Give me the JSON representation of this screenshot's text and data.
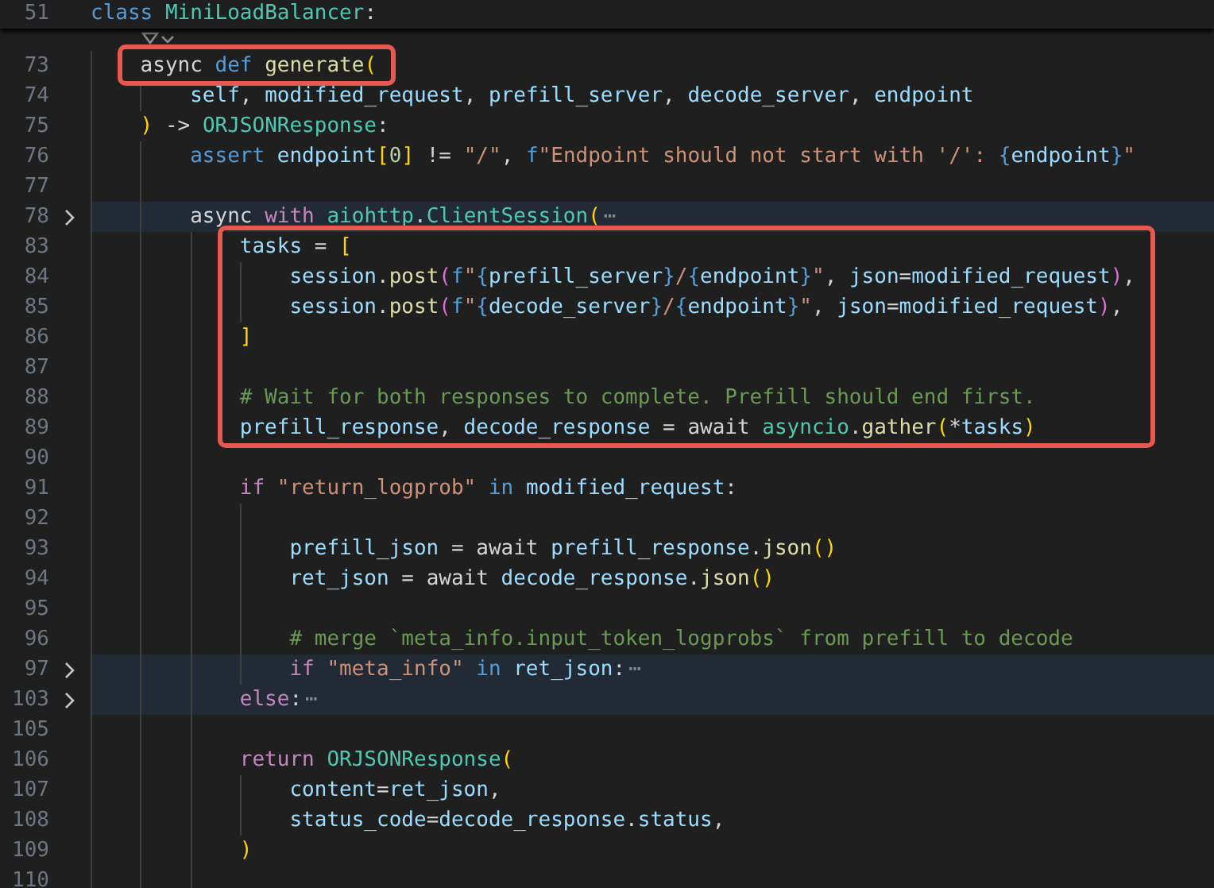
{
  "editor": {
    "sticky_line": {
      "number": "51",
      "tokens": [
        {
          "text": "class ",
          "kind": "kw"
        },
        {
          "text": "MiniLoadBalancer",
          "kind": "cls"
        },
        {
          "text": ":",
          "kind": "plain"
        }
      ]
    },
    "lines": [
      {
        "number": "73",
        "folded": false,
        "boxed": true,
        "tokens": [
          {
            "text": "async ",
            "kind": "plain"
          },
          {
            "text": "def ",
            "kind": "kw"
          },
          {
            "text": "generate",
            "kind": "fn"
          },
          {
            "text": "(",
            "kind": "br1"
          }
        ],
        "children": [
          {
            "number": "74",
            "folded": false,
            "boxed": false,
            "tokens": [
              {
                "text": "self",
                "kind": "var"
              },
              {
                "text": ", ",
                "kind": "plain"
              },
              {
                "text": "modified_request",
                "kind": "var"
              },
              {
                "text": ", ",
                "kind": "plain"
              },
              {
                "text": "prefill_server",
                "kind": "var"
              },
              {
                "text": ", ",
                "kind": "plain"
              },
              {
                "text": "decode_server",
                "kind": "var"
              },
              {
                "text": ", ",
                "kind": "plain"
              },
              {
                "text": "endpoint",
                "kind": "var"
              }
            ]
          }
        ]
      },
      {
        "number": "75",
        "folded": false,
        "boxed": false,
        "tokens": [
          {
            "text": ")",
            "kind": "br1"
          },
          {
            "text": " -> ",
            "kind": "plain"
          },
          {
            "text": "ORJSONResponse",
            "kind": "cls"
          },
          {
            "text": ":",
            "kind": "plain"
          }
        ],
        "children": [
          {
            "number": "76",
            "folded": false,
            "boxed": false,
            "tokens": [
              {
                "text": "assert ",
                "kind": "kw"
              },
              {
                "text": "endpoint",
                "kind": "var"
              },
              {
                "text": "[",
                "kind": "br1"
              },
              {
                "text": "0",
                "kind": "num"
              },
              {
                "text": "]",
                "kind": "br1"
              },
              {
                "text": " != ",
                "kind": "plain"
              },
              {
                "text": "\"/\"",
                "kind": "str"
              },
              {
                "text": ", ",
                "kind": "plain"
              },
              {
                "text": "f",
                "kind": "kw"
              },
              {
                "text": "\"Endpoint should not start with '/': ",
                "kind": "str"
              },
              {
                "text": "{",
                "kind": "fmt"
              },
              {
                "text": "endpoint",
                "kind": "var"
              },
              {
                "text": "}",
                "kind": "fmt"
              },
              {
                "text": "\"",
                "kind": "str"
              }
            ]
          },
          {
            "number": "77",
            "folded": false,
            "boxed": false
          },
          {
            "number": "78",
            "folded": true,
            "boxed": false,
            "tokens": [
              {
                "text": "async ",
                "kind": "plain"
              },
              {
                "text": "with ",
                "kind": "ctl"
              },
              {
                "text": "aiohttp",
                "kind": "cls"
              },
              {
                "text": ".",
                "kind": "plain"
              },
              {
                "text": "ClientSession",
                "kind": "cls"
              },
              {
                "text": "(",
                "kind": "br1"
              },
              {
                "text": "⋯",
                "kind": "fold"
              }
            ],
            "children": [
              {
                "number": "83",
                "folded": false,
                "boxed": true,
                "tokens": [
                  {
                    "text": "tasks",
                    "kind": "var"
                  },
                  {
                    "text": " = ",
                    "kind": "plain"
                  },
                  {
                    "text": "[",
                    "kind": "br1"
                  }
                ],
                "children": [
                  {
                    "number": "84",
                    "folded": false,
                    "boxed": true,
                    "tokens": [
                      {
                        "text": "session",
                        "kind": "var"
                      },
                      {
                        "text": ".",
                        "kind": "plain"
                      },
                      {
                        "text": "post",
                        "kind": "fn"
                      },
                      {
                        "text": "(",
                        "kind": "br2"
                      },
                      {
                        "text": "f",
                        "kind": "kw"
                      },
                      {
                        "text": "\"",
                        "kind": "str"
                      },
                      {
                        "text": "{",
                        "kind": "fmt"
                      },
                      {
                        "text": "prefill_server",
                        "kind": "var"
                      },
                      {
                        "text": "}",
                        "kind": "fmt"
                      },
                      {
                        "text": "/",
                        "kind": "str"
                      },
                      {
                        "text": "{",
                        "kind": "fmt"
                      },
                      {
                        "text": "endpoint",
                        "kind": "var"
                      },
                      {
                        "text": "}",
                        "kind": "fmt"
                      },
                      {
                        "text": "\"",
                        "kind": "str"
                      },
                      {
                        "text": ", ",
                        "kind": "plain"
                      },
                      {
                        "text": "json",
                        "kind": "var"
                      },
                      {
                        "text": "=",
                        "kind": "plain"
                      },
                      {
                        "text": "modified_request",
                        "kind": "var"
                      },
                      {
                        "text": ")",
                        "kind": "br2"
                      },
                      {
                        "text": ",",
                        "kind": "plain"
                      }
                    ]
                  },
                  {
                    "number": "85",
                    "folded": false,
                    "boxed": true,
                    "tokens": [
                      {
                        "text": "session",
                        "kind": "var"
                      },
                      {
                        "text": ".",
                        "kind": "plain"
                      },
                      {
                        "text": "post",
                        "kind": "fn"
                      },
                      {
                        "text": "(",
                        "kind": "br2"
                      },
                      {
                        "text": "f",
                        "kind": "kw"
                      },
                      {
                        "text": "\"",
                        "kind": "str"
                      },
                      {
                        "text": "{",
                        "kind": "fmt"
                      },
                      {
                        "text": "decode_server",
                        "kind": "var"
                      },
                      {
                        "text": "}",
                        "kind": "fmt"
                      },
                      {
                        "text": "/",
                        "kind": "str"
                      },
                      {
                        "text": "{",
                        "kind": "fmt"
                      },
                      {
                        "text": "endpoint",
                        "kind": "var"
                      },
                      {
                        "text": "}",
                        "kind": "fmt"
                      },
                      {
                        "text": "\"",
                        "kind": "str"
                      },
                      {
                        "text": ", ",
                        "kind": "plain"
                      },
                      {
                        "text": "json",
                        "kind": "var"
                      },
                      {
                        "text": "=",
                        "kind": "plain"
                      },
                      {
                        "text": "modified_request",
                        "kind": "var"
                      },
                      {
                        "text": ")",
                        "kind": "br2"
                      },
                      {
                        "text": ",",
                        "kind": "plain"
                      }
                    ]
                  }
                ]
              },
              {
                "number": "86",
                "folded": false,
                "boxed": true,
                "tokens": [
                  {
                    "text": "]",
                    "kind": "br1"
                  }
                ]
              },
              {
                "number": "87",
                "folded": false,
                "boxed": true
              },
              {
                "number": "88",
                "folded": false,
                "boxed": true,
                "tokens": [
                  {
                    "text": "# Wait for both responses to complete. Prefill should end first.",
                    "kind": "cmt"
                  }
                ]
              },
              {
                "number": "89",
                "folded": false,
                "boxed": true,
                "tokens": [
                  {
                    "text": "prefill_response",
                    "kind": "var"
                  },
                  {
                    "text": ", ",
                    "kind": "plain"
                  },
                  {
                    "text": "decode_response",
                    "kind": "var"
                  },
                  {
                    "text": " = ",
                    "kind": "plain"
                  },
                  {
                    "text": "await ",
                    "kind": "plain"
                  },
                  {
                    "text": "asyncio",
                    "kind": "cls"
                  },
                  {
                    "text": ".",
                    "kind": "plain"
                  },
                  {
                    "text": "gather",
                    "kind": "fn"
                  },
                  {
                    "text": "(",
                    "kind": "br1"
                  },
                  {
                    "text": "*",
                    "kind": "plain"
                  },
                  {
                    "text": "tasks",
                    "kind": "var"
                  },
                  {
                    "text": ")",
                    "kind": "br1"
                  }
                ]
              },
              {
                "number": "90",
                "folded": false,
                "boxed": false
              },
              {
                "number": "91",
                "folded": false,
                "boxed": false,
                "tokens": [
                  {
                    "text": "if ",
                    "kind": "ctl"
                  },
                  {
                    "text": "\"return_logprob\" ",
                    "kind": "str"
                  },
                  {
                    "text": "in ",
                    "kind": "kw"
                  },
                  {
                    "text": "modified_request",
                    "kind": "var"
                  },
                  {
                    "text": ":",
                    "kind": "plain"
                  }
                ],
                "children": [
                  {
                    "number": "92",
                    "folded": false,
                    "boxed": false
                  },
                  {
                    "number": "93",
                    "folded": false,
                    "boxed": false,
                    "tokens": [
                      {
                        "text": "prefill_json",
                        "kind": "var"
                      },
                      {
                        "text": " = ",
                        "kind": "plain"
                      },
                      {
                        "text": "await ",
                        "kind": "plain"
                      },
                      {
                        "text": "prefill_response",
                        "kind": "var"
                      },
                      {
                        "text": ".",
                        "kind": "plain"
                      },
                      {
                        "text": "json",
                        "kind": "fn"
                      },
                      {
                        "text": "()",
                        "kind": "br1"
                      }
                    ]
                  },
                  {
                    "number": "94",
                    "folded": false,
                    "boxed": false,
                    "tokens": [
                      {
                        "text": "ret_json",
                        "kind": "var"
                      },
                      {
                        "text": " = ",
                        "kind": "plain"
                      },
                      {
                        "text": "await ",
                        "kind": "plain"
                      },
                      {
                        "text": "decode_response",
                        "kind": "var"
                      },
                      {
                        "text": ".",
                        "kind": "plain"
                      },
                      {
                        "text": "json",
                        "kind": "fn"
                      },
                      {
                        "text": "()",
                        "kind": "br1"
                      }
                    ]
                  },
                  {
                    "number": "95",
                    "folded": false,
                    "boxed": false
                  },
                  {
                    "number": "96",
                    "folded": false,
                    "boxed": false,
                    "tokens": [
                      {
                        "text": "# merge `meta_info.input_token_logprobs` from prefill to decode",
                        "kind": "cmt"
                      }
                    ]
                  },
                  {
                    "number": "97",
                    "folded": true,
                    "boxed": false,
                    "tokens": [
                      {
                        "text": "if ",
                        "kind": "ctl"
                      },
                      {
                        "text": "\"meta_info\" ",
                        "kind": "str"
                      },
                      {
                        "text": "in ",
                        "kind": "kw"
                      },
                      {
                        "text": "ret_json",
                        "kind": "var"
                      },
                      {
                        "text": ":",
                        "kind": "plain"
                      },
                      {
                        "text": "⋯",
                        "kind": "fold"
                      }
                    ]
                  }
                ]
              },
              {
                "number": "103",
                "folded": true,
                "boxed": false,
                "tokens": [
                  {
                    "text": "else",
                    "kind": "ctl"
                  },
                  {
                    "text": ":",
                    "kind": "plain"
                  },
                  {
                    "text": "⋯",
                    "kind": "fold"
                  }
                ]
              },
              {
                "number": "105",
                "folded": false,
                "boxed": false
              },
              {
                "number": "106",
                "folded": false,
                "boxed": false,
                "tokens": [
                  {
                    "text": "return ",
                    "kind": "ctl"
                  },
                  {
                    "text": "ORJSONResponse",
                    "kind": "cls"
                  },
                  {
                    "text": "(",
                    "kind": "br1"
                  }
                ],
                "children": [
                  {
                    "number": "107",
                    "folded": false,
                    "boxed": false,
                    "tokens": [
                      {
                        "text": "content",
                        "kind": "var"
                      },
                      {
                        "text": "=",
                        "kind": "plain"
                      },
                      {
                        "text": "ret_json",
                        "kind": "var"
                      },
                      {
                        "text": ",",
                        "kind": "plain"
                      }
                    ]
                  },
                  {
                    "number": "108",
                    "folded": false,
                    "boxed": false,
                    "tokens": [
                      {
                        "text": "status_code",
                        "kind": "var"
                      },
                      {
                        "text": "=",
                        "kind": "plain"
                      },
                      {
                        "text": "decode_response",
                        "kind": "var"
                      },
                      {
                        "text": ".",
                        "kind": "plain"
                      },
                      {
                        "text": "status",
                        "kind": "var"
                      },
                      {
                        "text": ",",
                        "kind": "plain"
                      }
                    ]
                  }
                ]
              },
              {
                "number": "109",
                "folded": false,
                "boxed": false,
                "tokens": [
                  {
                    "text": ")",
                    "kind": "br1"
                  }
                ]
              },
              {
                "number": "110",
                "folded": false,
                "boxed": false
              }
            ]
          }
        ]
      }
    ]
  }
}
